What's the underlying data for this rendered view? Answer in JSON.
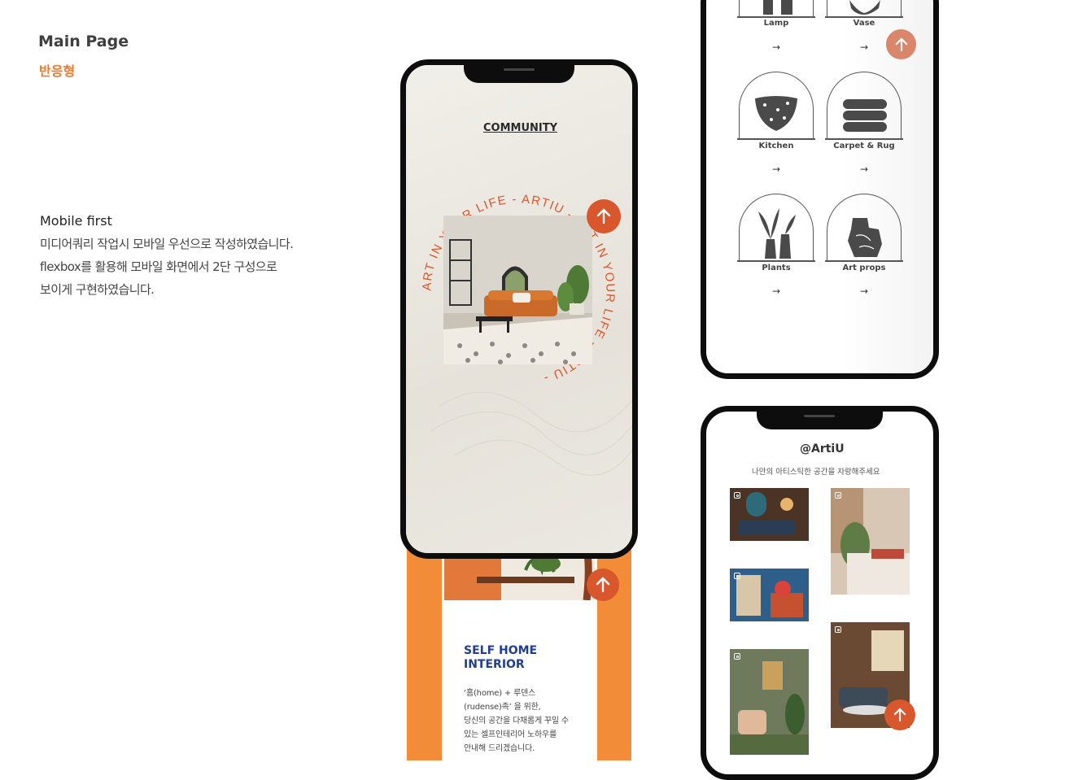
{
  "header": {
    "title": "Main Page",
    "subtitle": "반응형"
  },
  "description": {
    "heading": "Mobile first",
    "lines": [
      "미디어쿼리 작업시 모바일 우선으로 작성하였습니다.",
      "flexbox를 활용해 모바일 화면에서 2단 구성으로",
      "보이게 구현하였습니다."
    ]
  },
  "phone1": {
    "community_label": "COMMUNITY",
    "circle_text": "ART IN YOUR LIFE - ARTIU - ART IN YOUR LIFE - ARTIU -",
    "card_title_1": "SELF HOME",
    "card_title_2": "INTERIOR",
    "card_lines": [
      "‘홈(home) + 루덴스",
      "(rudense)족’ 을 위한,",
      "당신의 공간을 다채롭게 꾸밀 수",
      "있는 셀프인테리어 노하우를",
      "안내해 드리겠습니다."
    ]
  },
  "phone2": {
    "categories": [
      {
        "label": "Lamp",
        "arrow": "→"
      },
      {
        "label": "Vase",
        "arrow": "→"
      },
      {
        "label": "Kitchen",
        "arrow": "→"
      },
      {
        "label": "Carpet & Rug",
        "arrow": "→"
      },
      {
        "label": "Plants",
        "arrow": "→"
      },
      {
        "label": "Art props",
        "arrow": "→"
      }
    ]
  },
  "phone3": {
    "handle": "@ArtiU",
    "subtitle": "나만의 아티스틱한 공간을 자랑해주세요"
  },
  "colors": {
    "accent": "#ee7a2b",
    "button": "#d9572c",
    "orange_bg": "#f28c38",
    "navy": "#1f3e8f"
  }
}
